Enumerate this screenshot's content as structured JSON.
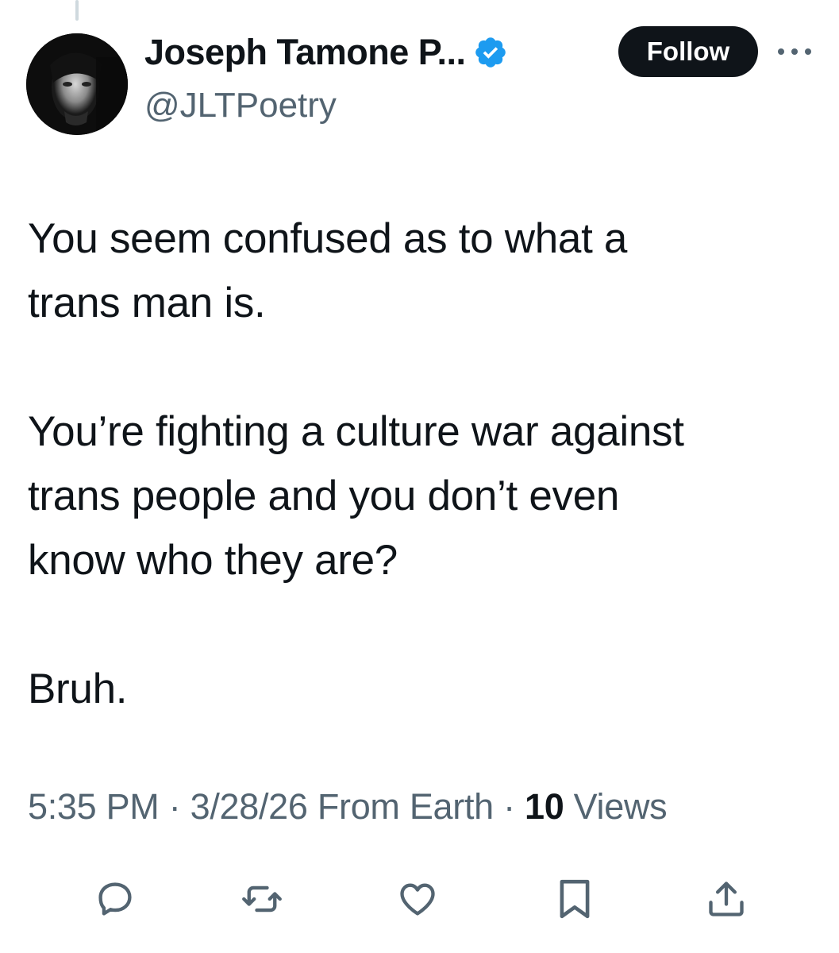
{
  "author": {
    "display_name": "Joseph Tamone P...",
    "handle": "@JLTPoetry",
    "verified": true,
    "verified_color": "#1d9bf0"
  },
  "header": {
    "follow_label": "Follow",
    "more_icon": "more-dots-icon"
  },
  "tweet": {
    "paragraphs": [
      "You seem confused as to what a\ntrans man is.",
      "You’re fighting a culture war against\ntrans people and you don’t even\nknow who they are?",
      "Bruh."
    ]
  },
  "meta": {
    "time": "5:35 PM",
    "separator": " · ",
    "date_source": "3/28/26 From Earth",
    "views_count": "10",
    "views_label": " Views"
  },
  "actions": {
    "icons": [
      "reply-icon",
      "retweet-icon",
      "like-icon",
      "bookmark-icon",
      "share-icon"
    ],
    "icon_color": "#536471"
  },
  "colors": {
    "text_primary": "#0f1419",
    "text_secondary": "#536471",
    "button_bg": "#0f1419",
    "thread_line": "#cfd9de"
  }
}
